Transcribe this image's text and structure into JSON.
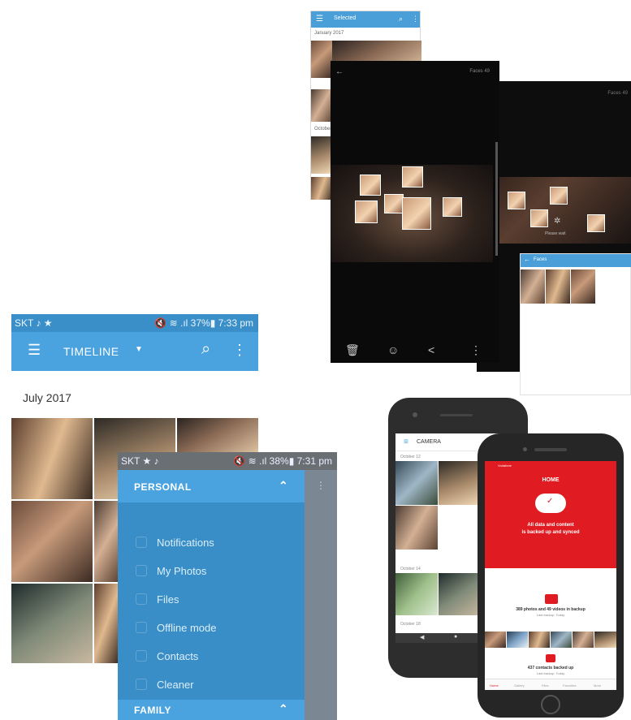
{
  "face_screens": {
    "screen1": {
      "bar_title": "Selected",
      "rows": [
        "January 2017",
        "October"
      ]
    },
    "screen2": {
      "counter": "Faces 49"
    },
    "screen3": {
      "counter": "Faces 49",
      "panel_title": "Faces",
      "spinner_label": "Please wait"
    }
  },
  "timeline_phone": {
    "status_left": "SKT ♪ ★",
    "status_right": "🔇 ≋ .ıl 37%▮ 7:33 pm",
    "toolbar_title": "TIMELINE",
    "month": "July 2017",
    "accent": "#4aa3df"
  },
  "drawer": {
    "status_left": "SKT ★ ♪",
    "status_right": "🔇 ≋ .ıl 38%▮ 7:31 pm",
    "personal_header": "PERSONAL",
    "items": [
      {
        "label": "Notifications",
        "icon": "bell-icon"
      },
      {
        "label": "My Photos",
        "icon": "photo-icon"
      },
      {
        "label": "Files",
        "icon": "folder-icon"
      },
      {
        "label": "Offline mode",
        "icon": "cloud-icon"
      },
      {
        "label": "Contacts",
        "icon": "contacts-icon"
      },
      {
        "label": "Cleaner",
        "icon": "brush-icon"
      }
    ],
    "family_header": "FAMILY"
  },
  "back_phone": {
    "header": "CAMERA",
    "dates": [
      "October 12",
      "October 14",
      "October 18"
    ]
  },
  "front_phone": {
    "status": "Vodafone",
    "title": "HOME",
    "message_line1": "All data and content",
    "message_line2": "is backed up and synced",
    "backup_count": "389 photos and 49 videos in backup",
    "backup_sub": "Last backup: Today",
    "contacts_count": "437 contacts backed up",
    "contacts_sub": "Last backup: Today",
    "tabs": [
      "Home",
      "Gallery",
      "Files",
      "Favorites",
      "More"
    ],
    "brand_red": "#e11b22"
  }
}
